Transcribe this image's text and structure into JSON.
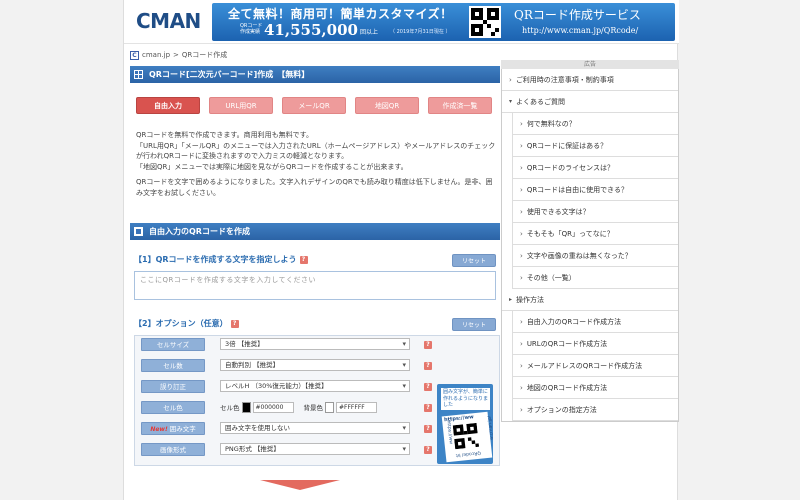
{
  "banner": {
    "logo": "CMAN",
    "ad_headline": "全て無料！商用可！簡単カスタマイズ！",
    "ad_label": "QRコード\n作成実績",
    "ad_count": "41,555,000",
    "ad_count_suffix": "回以上",
    "ad_date": "（ 2019年7月31日現在 ）",
    "ad_title": "QRコード作成サービス",
    "ad_url": "http://www.cman.jp/QRcode/"
  },
  "breadcrumb": {
    "favicon": "C",
    "site": "cman.jp",
    "sep": ">",
    "current": "QRコード作成"
  },
  "main": {
    "header": "QRコード[二次元バーコード]作成　【無料】",
    "tabs": [
      {
        "label": "自由入力",
        "active": true
      },
      {
        "label": "URL用QR",
        "active": false
      },
      {
        "label": "メールQR",
        "active": false
      },
      {
        "label": "地図QR",
        "active": false
      },
      {
        "label": "作成済一覧",
        "active": false
      }
    ],
    "desc": [
      "QRコードを無料で作成できます。商用利用も無料です。",
      "「URL用QR」「メールQR」のメニューでは入力されたURL（ホームページアドレス）やメールアドレスのチェックが行われQRコードに変換されますので入力ミスの軽減となります。",
      "「地図QR」メニューでは実際に地図を見ながらQRコードを作成することが出来ます。",
      "QRコードを文字で囲めるようになりました。文字入れデザインのQRでも読み取り精度は低下しません。是非、囲み文字をお試しください。"
    ],
    "sub_header": "自由入力のQRコードを作成",
    "step1": {
      "title": "【1】QRコードを作成する文字を指定しよう",
      "help": "?",
      "reset": "リセット",
      "placeholder": "ここにQRコードを作成する文字を入力してください"
    },
    "step2": {
      "title": "【2】オプション（任意）",
      "help": "?",
      "reset": "リセット"
    },
    "options": [
      {
        "label": "セルサイズ",
        "value": "3倍 【推奨】"
      },
      {
        "label": "セル数",
        "value": "自動判別 【推奨】"
      },
      {
        "label": "誤り訂正",
        "value": "レベルH （30%復元能力）【推奨】"
      },
      {
        "label": "セル色",
        "color_label": "セル色",
        "color_hex": "#000000",
        "bg_label": "背景色",
        "bg_hex": "#FFFFFF"
      },
      {
        "label": "囲み文字",
        "new": "New!",
        "value": "囲み文字を使用しない"
      },
      {
        "label": "画像形式",
        "value": "PNG形式 【推奨】"
      }
    ],
    "promo": {
      "text": "囲み文字が、簡単に作れるようになりました",
      "url": "https://ww",
      "side_left": "https://ww",
      "side_right": "w.cman.jp/",
      "bottom": "QRcode/ ht"
    }
  },
  "sidebar": {
    "ad_tag": "広告",
    "items": [
      {
        "label": "ご利用時の注意事項・制約事項",
        "level": 0,
        "icon": "chevron-right-icon"
      },
      {
        "label": "よくあるご質問",
        "level": 0,
        "icon": "triangle-down-icon"
      },
      {
        "label": "何で無料なの？",
        "level": 1,
        "icon": "chevron-right-icon"
      },
      {
        "label": "QRコードに保証はある？",
        "level": 1,
        "icon": "chevron-right-icon"
      },
      {
        "label": "QRコードのライセンスは？",
        "level": 1,
        "icon": "chevron-right-icon"
      },
      {
        "label": "QRコードは自由に使用できる？",
        "level": 1,
        "icon": "chevron-right-icon"
      },
      {
        "label": "使用できる文字は？",
        "level": 1,
        "icon": "chevron-right-icon"
      },
      {
        "label": "そもそも「QR」ってなに？",
        "level": 1,
        "icon": "chevron-right-icon"
      },
      {
        "label": "文字や画像の重ねは無くなった？",
        "level": 1,
        "icon": "chevron-right-icon"
      },
      {
        "label": "その他（一覧）",
        "level": 1,
        "icon": "chevron-right-icon"
      },
      {
        "label": "操作方法",
        "level": 0,
        "icon": "triangle-right-icon"
      },
      {
        "label": "自由入力のQRコード作成方法",
        "level": 1,
        "icon": "chevron-right-icon"
      },
      {
        "label": "URLのQRコード作成方法",
        "level": 1,
        "icon": "chevron-right-icon"
      },
      {
        "label": "メールアドレスのQRコード作成方法",
        "level": 1,
        "icon": "chevron-right-icon"
      },
      {
        "label": "地図のQRコード作成方法",
        "level": 1,
        "icon": "chevron-right-icon"
      },
      {
        "label": "オプションの指定方法",
        "level": 1,
        "icon": "chevron-right-icon"
      }
    ]
  },
  "colors": {
    "header_blue": "#2b63a6",
    "tab_active": "#d9534f",
    "tab_inactive": "#ee9b9b",
    "reset_button": "#87a9d4",
    "option_label": "#8fb0d8",
    "help_icon": "#e5766c",
    "cell_color": "#000000",
    "bg_color": "#FFFFFF"
  }
}
